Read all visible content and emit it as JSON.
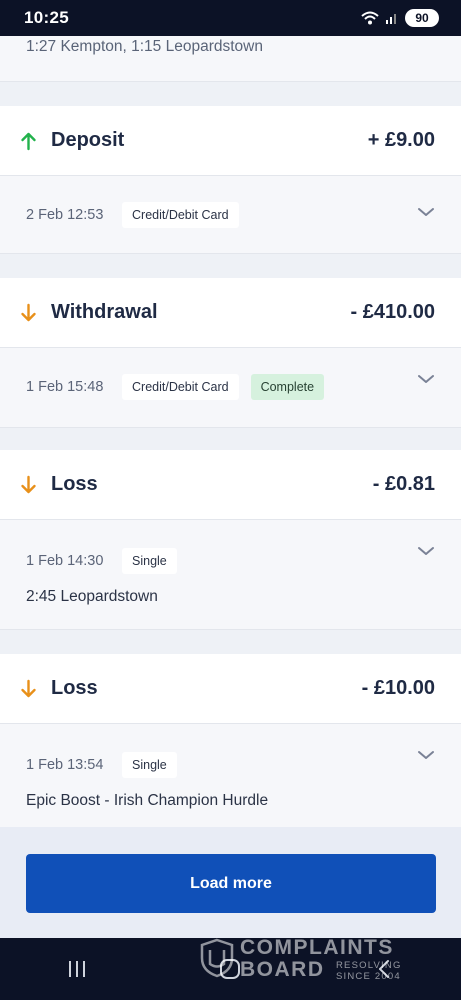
{
  "status_bar": {
    "time": "10:25",
    "battery": "90"
  },
  "top_strip": {
    "text": "1:27 Kempton, 1:15 Leopardstown"
  },
  "transactions": [
    {
      "type": "Deposit",
      "direction": "up",
      "amount": "+ £9.00",
      "date": "2 Feb 12:53",
      "chips": [
        "Credit/Debit Card"
      ],
      "status": "",
      "description": ""
    },
    {
      "type": "Withdrawal",
      "direction": "down",
      "amount": "- £410.00",
      "date": "1 Feb 15:48",
      "chips": [
        "Credit/Debit Card"
      ],
      "status": "Complete",
      "description": ""
    },
    {
      "type": "Loss",
      "direction": "down",
      "amount": "- £0.81",
      "date": "1 Feb 14:30",
      "chips": [
        "Single"
      ],
      "status": "",
      "description": "2:45 Leopardstown"
    },
    {
      "type": "Loss",
      "direction": "down",
      "amount": "- £10.00",
      "date": "1 Feb 13:54",
      "chips": [
        "Single"
      ],
      "status": "",
      "description": "Epic Boost - Irish Champion Hurdle"
    }
  ],
  "load_more_label": "Load more",
  "watermark": {
    "line1": "COMPLAINTS",
    "line2": "BOARD",
    "sub1": "RESOLVING",
    "sub2": "SINCE 2004"
  },
  "colors": {
    "accent": "#1050b8",
    "up_arrow": "#22b24c",
    "down_arrow": "#e8901a",
    "complete_bg": "#d6f1de",
    "nav_bg": "#0c1226"
  },
  "icons": {
    "up": "arrow-up-icon",
    "down": "arrow-down-icon",
    "expand": "chevron-down-icon"
  }
}
